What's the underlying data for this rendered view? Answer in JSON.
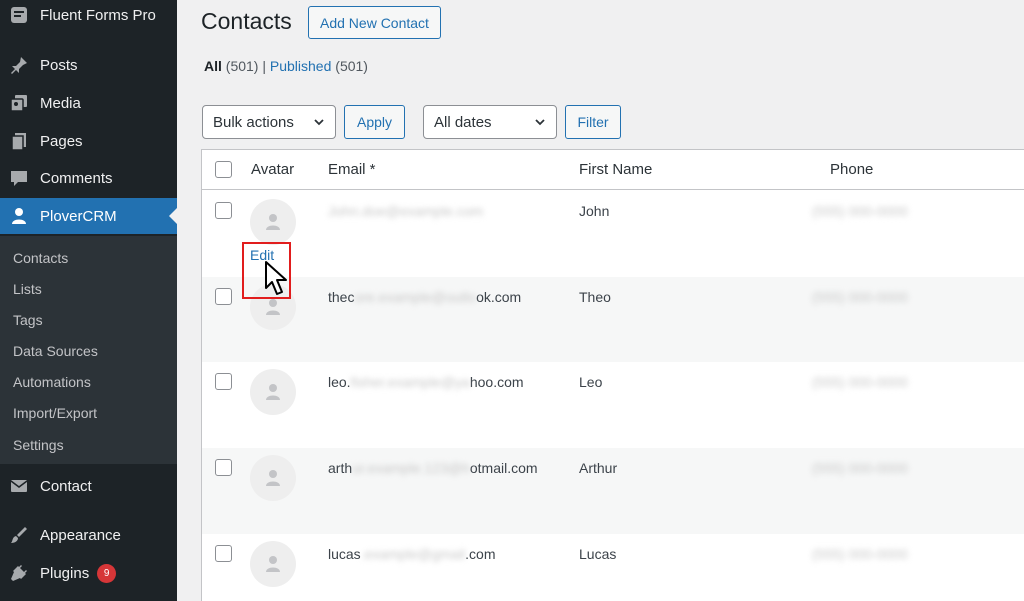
{
  "sidebar": {
    "site_name": "Fluent Forms Pro",
    "menu": [
      {
        "label": "Posts",
        "icon": "pin-icon"
      },
      {
        "label": "Media",
        "icon": "media-icon"
      },
      {
        "label": "Pages",
        "icon": "pages-icon"
      },
      {
        "label": "Comments",
        "icon": "comments-icon"
      },
      {
        "label": "PloverCRM",
        "icon": "user-icon",
        "active": true
      },
      {
        "label": "Contact",
        "icon": "mail-icon"
      },
      {
        "label": "Appearance",
        "icon": "brush-icon"
      },
      {
        "label": "Plugins",
        "icon": "plug-icon",
        "badge": "9"
      }
    ],
    "submenu": [
      "Contacts",
      "Lists",
      "Tags",
      "Data Sources",
      "Automations",
      "Import/Export",
      "Settings"
    ]
  },
  "header": {
    "title": "Contacts",
    "add_new_label": "Add New Contact"
  },
  "filters": {
    "all_label": "All",
    "all_count": "(501)",
    "separator": "|",
    "published_label": "Published",
    "published_count": "(501)",
    "bulk_actions": "Bulk actions",
    "apply_label": "Apply",
    "dates": "All dates",
    "filter_label": "Filter"
  },
  "table": {
    "columns": {
      "avatar": "Avatar",
      "email": "Email *",
      "first_name": "First Name",
      "phone": "Phone"
    },
    "rows": [
      {
        "email_visible": "",
        "email_blurred": "John.doe@example.com",
        "email_tail": "",
        "first_name": "John",
        "phone": "(555) 000-0000",
        "edit_label": "Edit"
      },
      {
        "email_visible": "thec",
        "email_blurred": "ore.example@outlo",
        "email_tail": "ok.com",
        "first_name": "Theo",
        "phone": "(555) 000-0000"
      },
      {
        "email_visible": "leo.",
        "email_blurred": "fisher.example@ya",
        "email_tail": "hoo.com",
        "first_name": "Leo",
        "phone": "(555) 000-0000"
      },
      {
        "email_visible": "arth",
        "email_blurred": "ur.example.123@h",
        "email_tail": "otmail.com",
        "first_name": "Arthur",
        "phone": "(555) 000-0000"
      },
      {
        "email_visible": "lucas",
        "email_blurred": ".example@gmail",
        "email_tail": ".com",
        "first_name": "Lucas",
        "phone": "(555) 000-0000"
      }
    ]
  },
  "colors": {
    "accent": "#2271b1",
    "sidebar_bg": "#1d2327",
    "highlight": "#e11d1d"
  }
}
